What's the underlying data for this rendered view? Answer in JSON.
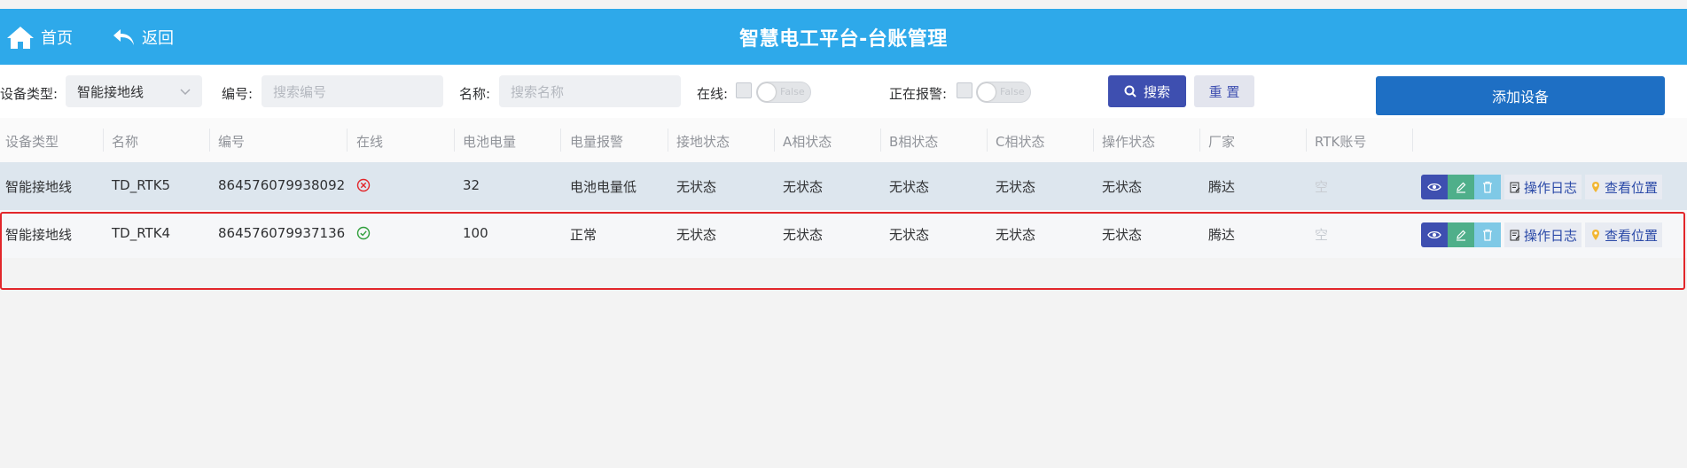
{
  "header": {
    "home_label": "首页",
    "back_label": "返回",
    "title": "智慧电工平台-台账管理",
    "bg_color": "#2ea9ea"
  },
  "filters": {
    "device_type_label": "设备类型:",
    "device_type_value": "智能接地线",
    "number_label": "编号:",
    "number_placeholder": "搜索编号",
    "name_label": "名称:",
    "name_placeholder": "搜索名称",
    "online_label": "在线:",
    "online_switch_text": "False",
    "alarm_label": "正在报警:",
    "alarm_switch_text": "False",
    "search_label": "搜索",
    "reset_label": "重 置",
    "add_label": "添加设备"
  },
  "table": {
    "columns": [
      "设备类型",
      "名称",
      "编号",
      "在线",
      "电池电量",
      "电量报警",
      "接地状态",
      "A相状态",
      "B相状态",
      "C相状态",
      "操作状态",
      "厂家",
      "RTK账号"
    ],
    "rows": [
      {
        "device_type": "智能接地线",
        "name": "TD_RTK5",
        "number": "864576079938092",
        "online": "offline",
        "battery": "32",
        "battery_alarm": "电池电量低",
        "ground_state": "无状态",
        "a_state": "无状态",
        "b_state": "无状态",
        "c_state": "无状态",
        "op_state": "无状态",
        "vendor": "腾达",
        "rtk": "空"
      },
      {
        "device_type": "智能接地线",
        "name": "TD_RTK4",
        "number": "864576079937136",
        "online": "online",
        "battery": "100",
        "battery_alarm": "正常",
        "ground_state": "无状态",
        "a_state": "无状态",
        "b_state": "无状态",
        "c_state": "无状态",
        "op_state": "无状态",
        "vendor": "腾达",
        "rtk": "空"
      }
    ],
    "actions": {
      "log_label": "操作日志",
      "location_label": "查看位置"
    }
  },
  "colors": {
    "primary": "#3e4fb0",
    "add_button": "#1e6fc4",
    "edit": "#4faf8a",
    "delete": "#7fc9e6",
    "offline": "#e2262a",
    "online": "#2e9e3a",
    "highlight_border": "#e2262a"
  }
}
